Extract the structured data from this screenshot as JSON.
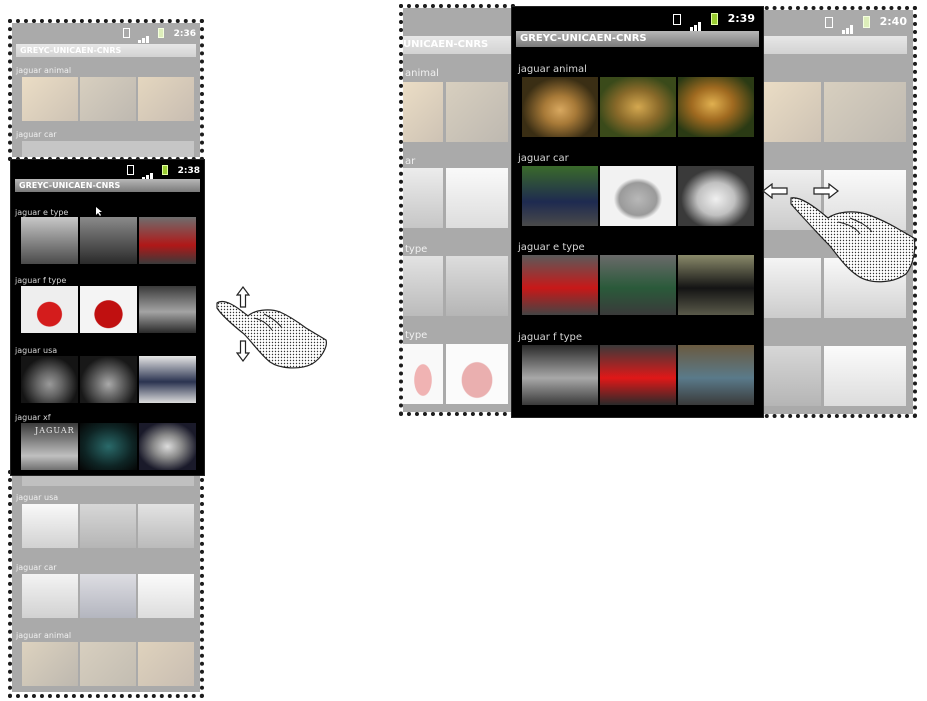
{
  "app_title": "GREYC-UNICAEN-CNRS",
  "times": {
    "top_faded": "2:36",
    "left_main": "2:38",
    "right_main": "2:39",
    "right_faded": "2:40"
  },
  "categories": {
    "jaguar_animal": "jaguar animal",
    "jaguar_car": "jaguar car",
    "jaguar_e_type": "jaguar e type",
    "jaguar_f_type": "jaguar f type",
    "jaguar_usa": "jaguar usa",
    "jaguar_xf": "jaguar xf"
  },
  "partial_labels": {
    "animal": "animal",
    "ar": "ar",
    "type": "type",
    "unicaen": "UNICAEN-CNRS"
  },
  "thumb_texts": {
    "jaguar_logo": "JAGUAR"
  },
  "colors": {
    "frame": "#1c1c1c",
    "screen_bg": "#000000",
    "title_bar": "#9a9a9a",
    "battery": "#9acd32"
  }
}
